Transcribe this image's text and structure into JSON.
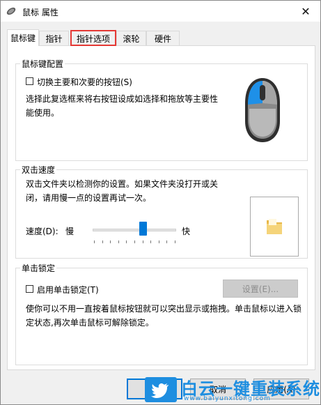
{
  "window": {
    "title": "鼠标 属性",
    "close_icon": "close-icon"
  },
  "tabs": [
    {
      "label": "鼠标键",
      "active": true
    },
    {
      "label": "指针",
      "active": false
    },
    {
      "label": "指针选项",
      "active": false,
      "highlighted": true
    },
    {
      "label": "滚轮",
      "active": false
    },
    {
      "label": "硬件",
      "active": false
    }
  ],
  "button_config": {
    "title": "鼠标键配置",
    "checkbox_label": "切换主要和次要的按钮(S)",
    "checked": false,
    "description": "选择此复选框来将右按钮设成如选择和拖放等主要性能使用。",
    "image_icon": "mouse-icon"
  },
  "double_click": {
    "title": "双击速度",
    "description": "双击文件夹以检测你的设置。如果文件夹没打开或关闭，请用慢一点的设置再试一次。",
    "speed_label": "速度(D):",
    "slow_label": "慢",
    "fast_label": "快",
    "speed_level": 0.6,
    "folder_icon": "folder-icon"
  },
  "click_lock": {
    "title": "单击锁定",
    "checkbox_label": "启用单击锁定(T)",
    "checked": false,
    "settings_button": "设置(E)...",
    "description": "使你可以不用一直按着鼠标按钮就可以突出显示或拖拽。单击鼠标以进入锁定状态,再次单击鼠标可解除锁定。"
  },
  "footer": {
    "ok_label": "确定",
    "cancel_label": "取消",
    "apply_label": "应用(A)"
  },
  "watermark": {
    "brand": "白云一键重装系统",
    "url": "www.baiyunxitong.com",
    "icon": "twitter-bird-icon"
  },
  "colors": {
    "accent": "#0078d7",
    "highlight_border": "#e53935",
    "watermark": "#1e8ee0"
  }
}
